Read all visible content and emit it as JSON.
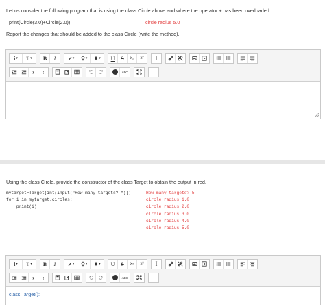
{
  "q1": {
    "intro": "Let us consider the following program that is using the class Circle above and where the operator + has been overloaded.",
    "code": "print(Circle(3.0)+Circle(2.0))",
    "output": "circle radius 5.0",
    "task": "Report the changes that should be added to the class Circle (write the method)."
  },
  "q2": {
    "intro": "Using the class Circle, provide the constructor of the class Target to obtain the output in red.",
    "code_lines": [
      "mytarget=Target(int(input(\"How many targets? \")))",
      "for i in mytarget.circles:",
      "    print(i)"
    ],
    "output_lines": [
      "How many targets? 5",
      "circle radius 1.0",
      "circle radius 2.0",
      "circle radius 3.0",
      "circle radius 4.0",
      "circle radius 5.0"
    ],
    "answer": "class Target():"
  },
  "toolbar": {
    "row1": [
      [
        "info-dropdown-button",
        "format-dropdown-button"
      ],
      [
        "bold-button",
        "italic-button"
      ],
      [
        "font-color-button",
        "highlight-button",
        "fill-button"
      ],
      [
        "underline-button",
        "strikethrough-button",
        "subscript-button",
        "superscript-button"
      ],
      [
        "text-cursor-button"
      ],
      [
        "link-button",
        "unlink-button"
      ],
      [
        "image-button",
        "media-button"
      ],
      [
        "bullet-list-button",
        "numbered-list-button"
      ],
      [
        "align-left-button",
        "align-center-button"
      ]
    ],
    "row2": [
      [
        "outdent-button",
        "indent-button",
        "ltr-button",
        "rtl-button"
      ],
      [
        "equation-button",
        "edit-button",
        "table-button"
      ],
      [
        "undo-button",
        "redo-button"
      ],
      [
        "accessibility-button",
        "spellcheck-button"
      ],
      [
        "fullscreen-button"
      ],
      [
        "html-button"
      ]
    ],
    "labels": {
      "info": "i",
      "format": "T",
      "bold": "B",
      "italic": "I",
      "underline": "U",
      "strike": "S",
      "sub": "x₂",
      "sup": "x²",
      "cursor": "I",
      "html": "</>",
      "accessibility": "i",
      "spell": "ABC"
    }
  }
}
